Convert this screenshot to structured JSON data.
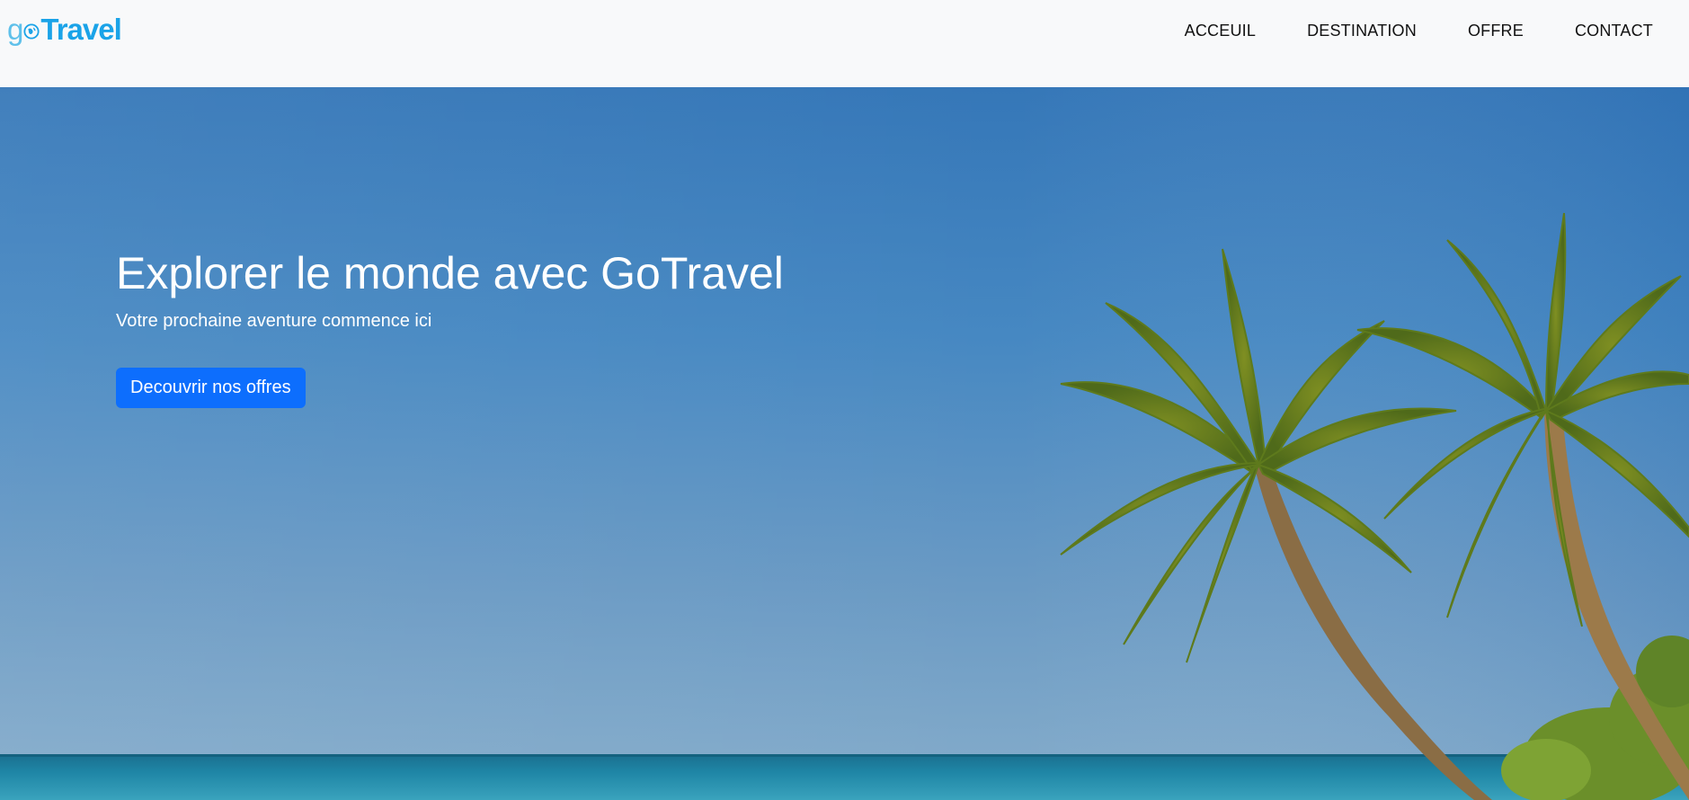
{
  "brand": {
    "prefix": "go",
    "name": "Travel",
    "color": "#1aa3e8"
  },
  "nav": {
    "links": [
      {
        "label": "ACCEUIL"
      },
      {
        "label": "DESTINATION"
      },
      {
        "label": "OFFRE"
      },
      {
        "label": "CONTACT"
      }
    ]
  },
  "hero": {
    "title": "Explorer le monde avec GoTravel",
    "subtitle": "Votre prochaine aventure commence ici",
    "cta_label": "Decouvrir nos offres",
    "cta_color": "#0d6efd",
    "background_image": "tropical-beach-palm-trees"
  }
}
